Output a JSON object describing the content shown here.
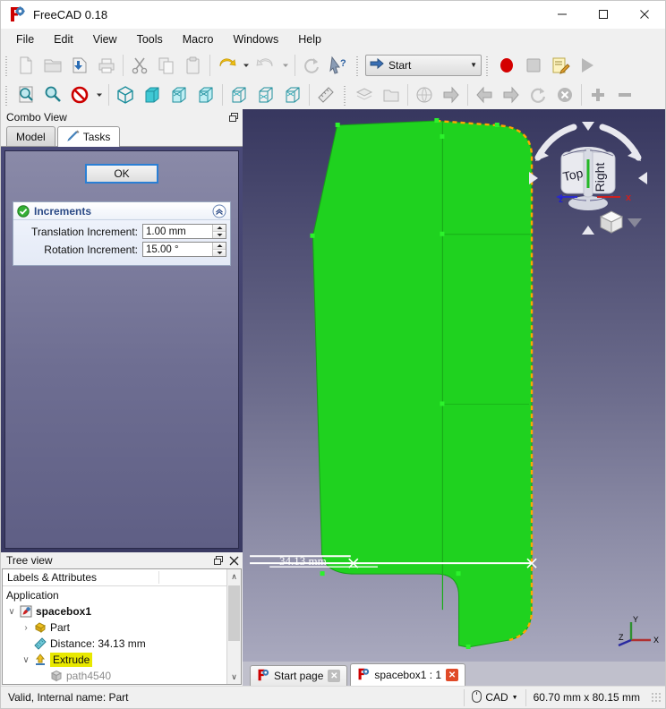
{
  "window": {
    "title": "FreeCAD 0.18",
    "app_icon": "freecad-logo-icon",
    "minimize_label": "–",
    "maximize_label": "☐",
    "close_label": "✕"
  },
  "menubar": {
    "items": [
      {
        "label": "File"
      },
      {
        "label": "Edit"
      },
      {
        "label": "View"
      },
      {
        "label": "Tools"
      },
      {
        "label": "Macro"
      },
      {
        "label": "Windows"
      },
      {
        "label": "Help"
      }
    ]
  },
  "toolbars": {
    "file_row": [
      {
        "name": "new-document-icon",
        "disabled": true
      },
      {
        "name": "open-document-icon",
        "disabled": true
      },
      {
        "name": "save-document-icon",
        "disabled": false
      },
      {
        "name": "print-document-icon",
        "disabled": true
      },
      {
        "name": "cut-icon",
        "disabled": true
      },
      {
        "name": "copy-icon",
        "disabled": true
      },
      {
        "name": "paste-icon",
        "disabled": true
      },
      {
        "name": "undo-icon",
        "disabled": false
      },
      {
        "name": "undo-dropdown-arrow-icon",
        "disabled": false
      },
      {
        "name": "redo-icon",
        "disabled": true
      },
      {
        "name": "redo-dropdown-arrow-icon",
        "disabled": true
      },
      {
        "name": "refresh-icon",
        "disabled": true
      },
      {
        "name": "whats-this-icon",
        "disabled": false
      }
    ],
    "workbench": {
      "name": "workbench-selector",
      "value": "Start",
      "icon": "start-arrow-icon",
      "arrow": "▼"
    },
    "macro_row": [
      {
        "name": "macro-record-icon"
      },
      {
        "name": "macro-stop-icon"
      },
      {
        "name": "macro-edit-icon"
      },
      {
        "name": "macro-execute-icon"
      }
    ],
    "view_row": [
      {
        "name": "fit-all-icon"
      },
      {
        "name": "fit-selection-icon"
      },
      {
        "name": "draw-style-icon"
      },
      {
        "name": "draw-style-dropdown-arrow-icon"
      },
      {
        "name": "isometric-view-icon"
      },
      {
        "name": "front-view-icon"
      },
      {
        "name": "top-view-icon"
      },
      {
        "name": "right-view-icon"
      },
      {
        "name": "rear-view-icon"
      },
      {
        "name": "bottom-view-icon"
      },
      {
        "name": "left-view-icon"
      },
      {
        "name": "measure-icon"
      }
    ],
    "struct_row": [
      {
        "name": "create-part-icon",
        "disabled": true
      },
      {
        "name": "create-group-icon",
        "disabled": true
      },
      {
        "name": "set-url-icon",
        "disabled": true
      },
      {
        "name": "link-forward-icon",
        "disabled": false
      },
      {
        "name": "nav-back-icon",
        "disabled": false
      },
      {
        "name": "nav-forward-icon",
        "disabled": false
      },
      {
        "name": "nav-refresh-icon",
        "disabled": false
      },
      {
        "name": "nav-stop-icon",
        "disabled": false
      },
      {
        "name": "zoom-in-icon",
        "disabled": false
      },
      {
        "name": "zoom-out-icon",
        "disabled": false
      }
    ]
  },
  "combo_view": {
    "title": "Combo View",
    "float_icon": "undock-icon",
    "tabs": [
      {
        "label": "Model",
        "icon": "model-tree-icon",
        "active": false
      },
      {
        "label": "Tasks",
        "icon": "pencil-icon",
        "active": true
      }
    ],
    "ok_button": "OK",
    "increments": {
      "title": "Increments",
      "status_icon": "green-check-icon",
      "collapse_icon": "chevron-up-icon",
      "rows": [
        {
          "label": "Translation Increment:",
          "value": "1.00 mm"
        },
        {
          "label": "Rotation Increment:",
          "value": "15.00 °"
        }
      ]
    }
  },
  "tree_view": {
    "title": "Tree view",
    "float_icon": "undock-icon",
    "close_icon": "close-icon",
    "header": {
      "col1": "Labels & Attributes",
      "col2": ""
    },
    "root_label": "Application",
    "items": [
      {
        "label": "spacebox1",
        "icon": "document-icon",
        "indent": 0,
        "twisty": "∨",
        "bold": true,
        "highlighted": false,
        "dim": false
      },
      {
        "label": "Part",
        "icon": "part-icon",
        "indent": 1,
        "twisty": "›",
        "bold": false,
        "highlighted": false,
        "dim": false
      },
      {
        "label": "Distance: 34.13 mm",
        "icon": "measure-icon",
        "indent": 1,
        "twisty": "",
        "bold": false,
        "highlighted": false,
        "dim": false
      },
      {
        "label": "Extrude",
        "icon": "extrude-icon",
        "indent": 1,
        "twisty": "∨",
        "bold": false,
        "highlighted": true,
        "dim": false
      },
      {
        "label": "path4540",
        "icon": "shape-icon",
        "indent": 2,
        "twisty": "",
        "bold": false,
        "highlighted": false,
        "dim": true
      }
    ],
    "scroll_up": "∧",
    "scroll_down": "∨"
  },
  "view3d": {
    "dimension_label": "34.13 mm",
    "nav_cube": {
      "face_top": "Top",
      "face_right": "Right",
      "axis_x": "x",
      "axis_z": "z",
      "arrow_up": "▲",
      "arrow_down": "▼",
      "arrow_left": "◀",
      "arrow_right": "▶",
      "home_icon": "home-cube-icon",
      "menu_arrow": "▼"
    },
    "axis_cross": {
      "x": "X",
      "y": "Y",
      "z": "Z"
    },
    "colors": {
      "selection_green": "#1fd21f",
      "highlight_orange": "#ffa500",
      "background_top": "#37375f",
      "background_bottom": "#a9a9be"
    }
  },
  "doc_tabs": [
    {
      "label": "Start page",
      "icon": "freecad-logo-icon",
      "active": false,
      "close": "✕",
      "close_red": false
    },
    {
      "label": "spacebox1 : 1",
      "icon": "freecad-logo-icon",
      "active": true,
      "close": "✕",
      "close_red": true
    }
  ],
  "statusbar": {
    "message": "Valid, Internal name: Part",
    "nav_icon": "mouse-icon",
    "nav_style": "CAD",
    "nav_arrow": "▼",
    "dimensions": "60.70 mm x 80.15 mm"
  }
}
